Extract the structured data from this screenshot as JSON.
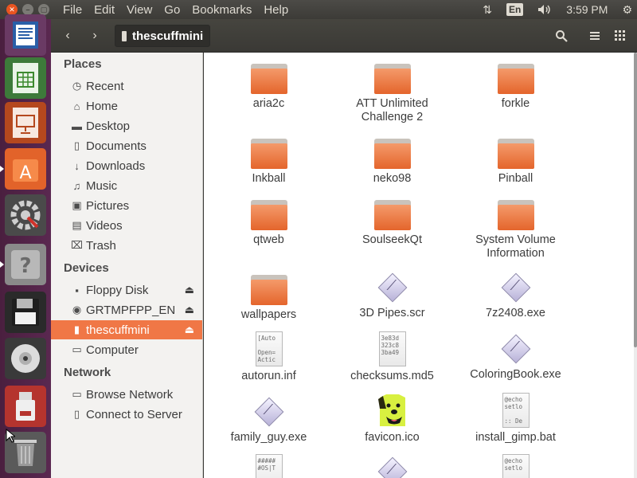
{
  "menubar": {
    "items": [
      "File",
      "Edit",
      "View",
      "Go",
      "Bookmarks",
      "Help"
    ]
  },
  "indicators": {
    "keyboard": "En",
    "time": "3:59 PM"
  },
  "toolbar": {
    "location": "thescuffmini"
  },
  "sidebar": {
    "places_header": "Places",
    "places": [
      {
        "label": "Recent",
        "icon": "clock-icon"
      },
      {
        "label": "Home",
        "icon": "home-icon"
      },
      {
        "label": "Desktop",
        "icon": "desktop-folder-icon"
      },
      {
        "label": "Documents",
        "icon": "document-icon"
      },
      {
        "label": "Downloads",
        "icon": "download-icon"
      },
      {
        "label": "Music",
        "icon": "music-icon"
      },
      {
        "label": "Pictures",
        "icon": "picture-icon"
      },
      {
        "label": "Videos",
        "icon": "video-icon"
      },
      {
        "label": "Trash",
        "icon": "trash-icon"
      }
    ],
    "devices_header": "Devices",
    "devices": [
      {
        "label": "Floppy Disk",
        "icon": "floppy-icon",
        "eject": true
      },
      {
        "label": "GRTMPFPP_EN",
        "icon": "optical-disc-icon",
        "eject": true
      },
      {
        "label": "thescuffmini",
        "icon": "usb-drive-icon",
        "eject": true,
        "active": true
      },
      {
        "label": "Computer",
        "icon": "computer-icon",
        "eject": false
      }
    ],
    "network_header": "Network",
    "network": [
      {
        "label": "Browse Network",
        "icon": "network-icon"
      },
      {
        "label": "Connect to Server",
        "icon": "server-icon"
      }
    ]
  },
  "files": [
    {
      "name": "aria2c",
      "type": "folder"
    },
    {
      "name": "ATT Unlimited Challenge 2",
      "type": "folder"
    },
    {
      "name": "forkle",
      "type": "folder"
    },
    {
      "name": "Inkball",
      "type": "folder"
    },
    {
      "name": "neko98",
      "type": "folder"
    },
    {
      "name": "Pinball",
      "type": "folder"
    },
    {
      "name": "qtweb",
      "type": "folder"
    },
    {
      "name": "SoulseekQt",
      "type": "folder"
    },
    {
      "name": "System Volume Information",
      "type": "folder"
    },
    {
      "name": "wallpapers",
      "type": "folder"
    },
    {
      "name": "3D Pipes.scr",
      "type": "exe"
    },
    {
      "name": "7z2408.exe",
      "type": "exe"
    },
    {
      "name": "autorun.inf",
      "type": "text",
      "preview": "[Auto\n\nOpen=\nActic"
    },
    {
      "name": "checksums.md5",
      "type": "text",
      "preview": "3e83d\n323c8\n3ba49"
    },
    {
      "name": "ColoringBook.exe",
      "type": "exe"
    },
    {
      "name": "family_guy.exe",
      "type": "exe"
    },
    {
      "name": "favicon.ico",
      "type": "image"
    },
    {
      "name": "install_gimp.bat",
      "type": "text",
      "preview": "@echo\nsetlo\n\n:: De"
    },
    {
      "name": "",
      "type": "text",
      "preview": "#####\n#OS|T"
    },
    {
      "name": "",
      "type": "exe"
    },
    {
      "name": "",
      "type": "text",
      "preview": "@echo\nsetlo"
    }
  ]
}
